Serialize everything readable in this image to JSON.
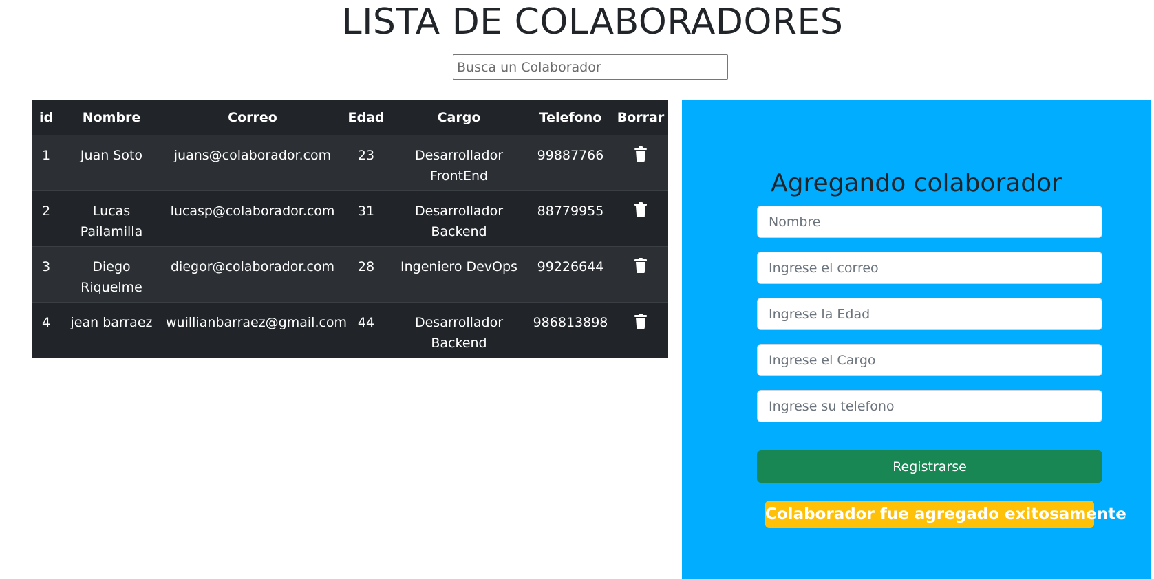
{
  "header": {
    "title": "LISTA DE COLABORADORES"
  },
  "search": {
    "placeholder": "Busca un Colaborador",
    "value": ""
  },
  "table": {
    "columns": [
      "id",
      "Nombre",
      "Correo",
      "Edad",
      "Cargo",
      "Telefono",
      "Borrar"
    ],
    "rows": [
      {
        "id": "1",
        "nombre": "Juan Soto",
        "correo": "juans@colaborador.com",
        "edad": "23",
        "cargo": "Desarrollador FrontEnd",
        "telefono": "99887766",
        "borrar_icon": "trash-icon"
      },
      {
        "id": "2",
        "nombre": "Lucas Pailamilla",
        "correo": "lucasp@colaborador.com",
        "edad": "31",
        "cargo": "Desarrollador Backend",
        "telefono": "88779955",
        "borrar_icon": "trash-icon"
      },
      {
        "id": "3",
        "nombre": "Diego Riquelme",
        "correo": "diegor@colaborador.com",
        "edad": "28",
        "cargo": "Ingeniero DevOps",
        "telefono": "99226644",
        "borrar_icon": "trash-icon"
      },
      {
        "id": "4",
        "nombre": "jean barraez",
        "correo": "wuillianbarraez@gmail.com",
        "edad": "44",
        "cargo": "Desarrollador Backend",
        "telefono": "986813898",
        "borrar_icon": "trash-icon"
      }
    ]
  },
  "form": {
    "title": "Agregando colaborador",
    "fields": {
      "nombre": {
        "placeholder": "Nombre",
        "value": ""
      },
      "correo": {
        "placeholder": "Ingrese el correo",
        "value": ""
      },
      "edad": {
        "placeholder": "Ingrese la Edad",
        "value": ""
      },
      "cargo": {
        "placeholder": "Ingrese el Cargo",
        "value": ""
      },
      "telefono": {
        "placeholder": "Ingrese su telefono",
        "value": ""
      }
    },
    "submit_label": "Registrarse",
    "alert_text": "Colaborador fue agregado exitosamente"
  },
  "colors": {
    "panel_bg": "#00adff",
    "table_bg": "#212529",
    "table_row_alt": "#2c3034",
    "submit_bg": "#198754",
    "alert_bg": "#ffc107"
  }
}
